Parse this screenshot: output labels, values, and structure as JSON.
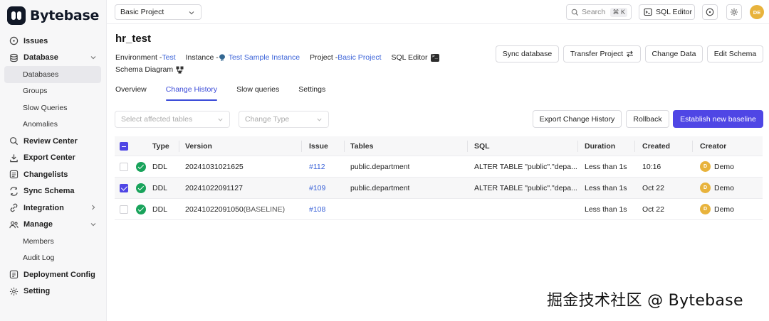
{
  "app": {
    "logo_text": "Bytebase"
  },
  "sidebar": {
    "items": [
      {
        "label": "Issues",
        "icon": "issues-icon"
      },
      {
        "label": "Database",
        "icon": "database-icon",
        "expanded": true
      },
      {
        "label": "Databases",
        "sub": true,
        "active": true
      },
      {
        "label": "Groups",
        "sub": true
      },
      {
        "label": "Slow Queries",
        "sub": true
      },
      {
        "label": "Anomalies",
        "sub": true
      },
      {
        "label": "Review Center",
        "icon": "review-center-icon"
      },
      {
        "label": "Export Center",
        "icon": "export-center-icon"
      },
      {
        "label": "Changelists",
        "icon": "changelists-icon"
      },
      {
        "label": "Sync Schema",
        "icon": "sync-schema-icon"
      },
      {
        "label": "Integration",
        "icon": "integration-icon"
      },
      {
        "label": "Manage",
        "icon": "manage-icon",
        "expanded": true
      },
      {
        "label": "Members",
        "sub": true
      },
      {
        "label": "Audit Log",
        "sub": true
      },
      {
        "label": "Deployment Config",
        "icon": "deployment-config-icon"
      },
      {
        "label": "Setting",
        "icon": "setting-icon"
      }
    ]
  },
  "topbar": {
    "project_select": "Basic Project",
    "search_placeholder": "Search",
    "search_shortcut": "⌘ K",
    "sql_editor_label": "SQL Editor",
    "avatar_initials": "DE"
  },
  "database": {
    "name": "hr_test",
    "environment_label": "Environment - ",
    "environment_value": "Test",
    "instance_label": "Instance - ",
    "instance_value": "Test Sample Instance",
    "project_label": "Project - ",
    "project_value": "Basic Project",
    "sql_editor_label": "SQL Editor",
    "schema_diagram_label": "Schema Diagram"
  },
  "actions": {
    "sync_database": "Sync database",
    "transfer_project": "Transfer Project",
    "change_data": "Change Data",
    "edit_schema": "Edit Schema"
  },
  "tabs": [
    {
      "label": "Overview"
    },
    {
      "label": "Change History",
      "active": true
    },
    {
      "label": "Slow queries"
    },
    {
      "label": "Settings"
    }
  ],
  "filters": {
    "affected_tables_placeholder": "Select affected tables",
    "change_type_placeholder": "Change Type"
  },
  "toolbar": {
    "export_change_history": "Export Change History",
    "rollback": "Rollback",
    "establish_baseline": "Establish new baseline"
  },
  "table": {
    "headers": {
      "type": "Type",
      "version": "Version",
      "issue": "Issue",
      "tables": "Tables",
      "sql": "SQL",
      "duration": "Duration",
      "created": "Created",
      "creator": "Creator"
    },
    "rows": [
      {
        "checked": false,
        "type": "DDL",
        "version": "20241031021625",
        "version_suffix": "",
        "issue": "#112",
        "tables": "public.department",
        "sql": "ALTER TABLE \"public\".\"depa...",
        "duration": "Less than 1s",
        "created": "10:16",
        "creator": "Demo",
        "creator_initial": "D"
      },
      {
        "checked": true,
        "type": "DDL",
        "version": "20241022091127",
        "version_suffix": "",
        "issue": "#109",
        "tables": "public.department",
        "sql": "ALTER TABLE \"public\".\"depa...",
        "duration": "Less than 1s",
        "created": "Oct 22",
        "creator": "Demo",
        "creator_initial": "D"
      },
      {
        "checked": false,
        "type": "DDL",
        "version": "20241022091050",
        "version_suffix": "(BASELINE)",
        "issue": "#108",
        "tables": "",
        "sql": "",
        "duration": "Less than 1s",
        "created": "Oct 22",
        "creator": "Demo",
        "creator_initial": "D"
      }
    ]
  },
  "watermark": "掘金技术社区 @ Bytebase",
  "colors": {
    "accent": "#4f46e5",
    "link": "#3b63d8",
    "success": "#19a35b",
    "avatar": "#e8b33c"
  }
}
